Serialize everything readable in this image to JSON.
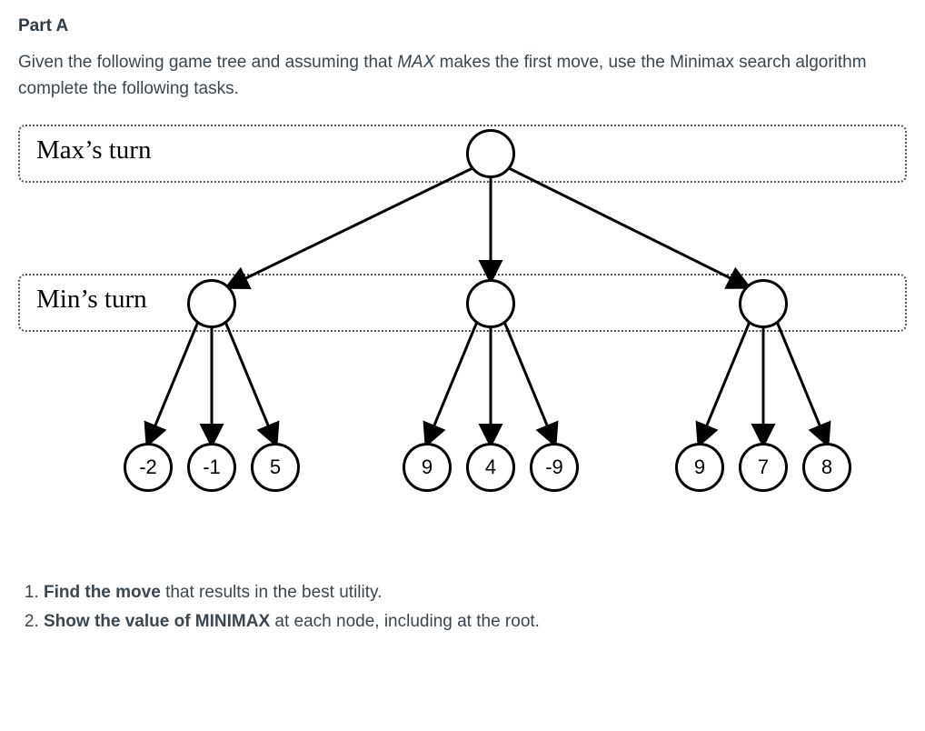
{
  "heading": "Part A",
  "intro_pre": "Given the following game tree and assuming that ",
  "intro_em": "MAX",
  "intro_post": " makes the first move, use the Minimax search algorithm complete the following tasks.",
  "labels": {
    "max": "Max’s turn",
    "min": "Min’s turn"
  },
  "leaves": {
    "l0": "-2",
    "l1": "-1",
    "l2": "5",
    "l3": "9",
    "l4": "4",
    "l5": "-9",
    "l6": "9",
    "l7": "7",
    "l8": "8"
  },
  "tasks": {
    "t1_bold": "Find the move",
    "t1_rest": " that results in the best utility.",
    "t2_bold": "Show the value of MINIMAX",
    "t2_rest": " at each node, including at the root."
  }
}
